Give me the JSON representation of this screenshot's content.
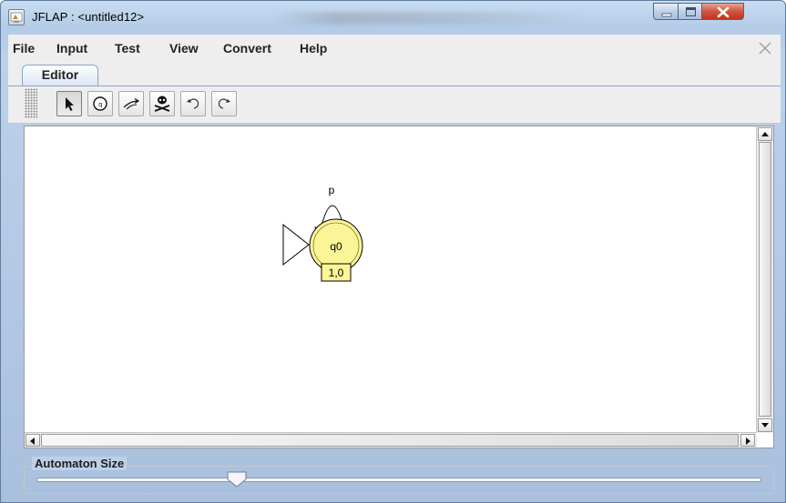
{
  "window": {
    "title": "JFLAP : <untitled12>"
  },
  "menu": {
    "items": [
      "File",
      "Input",
      "Test",
      "View",
      "Convert",
      "Help"
    ]
  },
  "tabs": [
    {
      "label": "Editor"
    }
  ],
  "toolbar": {
    "tools": [
      "attribute-editor",
      "state-creator",
      "transition-creator",
      "deleter",
      "undo",
      "redo"
    ]
  },
  "automaton": {
    "state": {
      "name": "q0",
      "label": "1,0",
      "initial": true,
      "fill": "#fbf597"
    },
    "loop_transition": {
      "symbol": "p"
    }
  },
  "size_panel": {
    "title": "Automaton Size",
    "slider_value_fraction": 0.29
  }
}
